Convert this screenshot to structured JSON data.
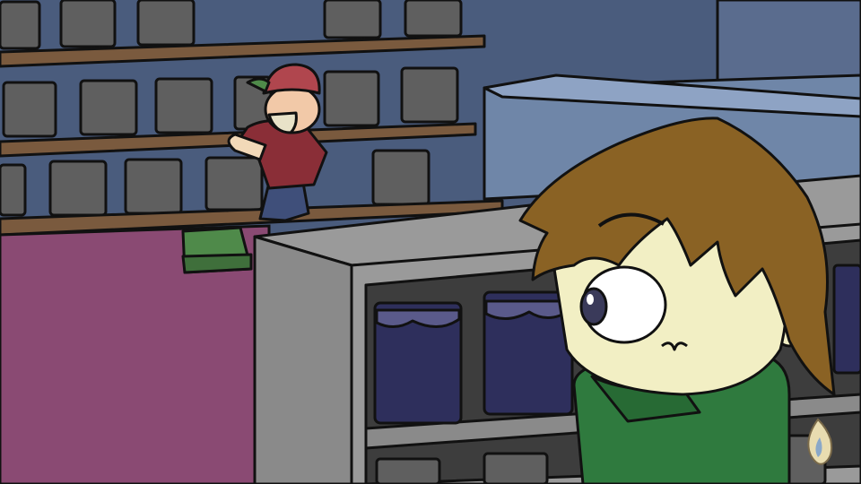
{
  "scene": {
    "colors": {
      "wall": "#4a5c7d",
      "wall_shadow": "#3e4e6b",
      "shelf_wood": "#7a5a3e",
      "game_box": "#5f5f5f",
      "counter_top": "#9a9a9a",
      "counter_front": "#8a8a8a",
      "counter_dark": "#3d3d3d",
      "magenta_wall": "#8a4a73",
      "skin": "#f2efc4",
      "hair": "#8a6224",
      "hoodie": "#2f7a3e",
      "navy_box": "#2e2f5c",
      "clerk_shirt": "#8a2e37",
      "clerk_cap": "#b0464e",
      "outline": "#111111"
    },
    "icons": [
      "watermark-flame-icon"
    ]
  }
}
